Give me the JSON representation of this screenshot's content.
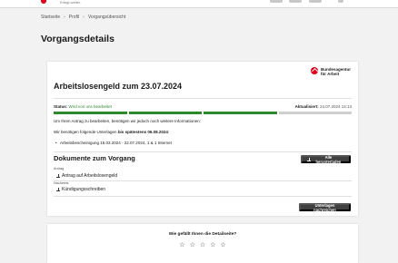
{
  "header": {
    "tagline": "Erlegt weiter."
  },
  "breadcrumb": [
    "Startseite",
    "Profil",
    "Vorgangsübersicht"
  ],
  "page_title": "Vorgangsdetails",
  "card": {
    "logo_line1": "Bundesagentur",
    "logo_line2": "für Arbeit",
    "title": "Arbeitslosengeld zum 23.07.2024",
    "status_label": "Status:",
    "status_value": "Wird von uns bearbeitet",
    "updated_label": "Aktualisiert:",
    "updated_value": "24.07.2024 14:13",
    "progress": {
      "completed_steps": 3,
      "total_steps": 4
    },
    "info1": "Um Ihren Antrag zu bearbeiten, benötigen wir jedoch noch weitere Informationen:",
    "info2_prefix": "Wir benötigen folgende Unterlagen",
    "info2_bold": "bis spätestens 06.08.2024",
    "info2_suffix": ":",
    "bullet": "Arbeitsbescheinigung 15.03.2024 - 22.07.2024, 1 & 1 Internet",
    "docs_title": "Dokumente zum Vorgang",
    "download_all_label": "Alle herunterladen",
    "groups": [
      {
        "label": "Antrag",
        "doc": "Antrag auf Arbeitslosengeld"
      },
      {
        "label": "Nachweis",
        "doc": "Kündigungsschreiben"
      }
    ],
    "upload_label": "Unterlagen nachreichen"
  },
  "feedback": {
    "question": "Wie gefällt Ihnen die Detailseite?",
    "stars": [
      "☆",
      "☆",
      "☆",
      "☆",
      "☆"
    ]
  },
  "colors": {
    "brand_red": "#e2001a",
    "status_green": "#2c8a2c",
    "button_dark": "#404040"
  }
}
